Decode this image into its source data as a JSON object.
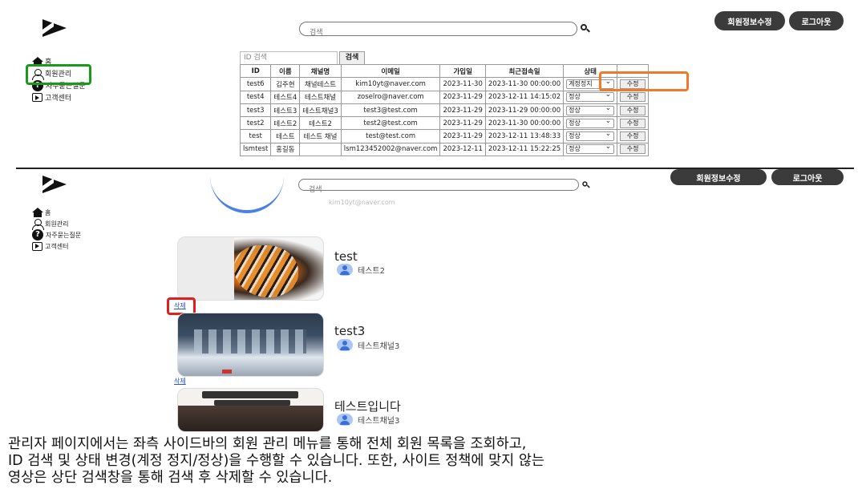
{
  "top": {
    "search_placeholder": "검색",
    "edit_profile_button": "회원정보수정",
    "logout_button": "로그아웃",
    "sidebar": [
      "홈",
      "회원관리",
      "자주묻는질문",
      "고객센터"
    ],
    "id_search_placeholder": "ID 검색",
    "id_search_button": "검색",
    "table": {
      "headers": [
        "ID",
        "이름",
        "채널명",
        "이메일",
        "가입일",
        "최근접속일",
        "상태",
        ""
      ],
      "rows": [
        {
          "id": "test6",
          "name": "김주현",
          "channel": "채널테스트",
          "email": "kim10yt@naver.com",
          "joined": "2023-11-30",
          "last": "2023-11-30 00:00:00",
          "status": "계정정지",
          "action": "수정"
        },
        {
          "id": "test4",
          "name": "테스트4",
          "channel": "테스트채널",
          "email": "zoselro@naver.com",
          "joined": "2023-11-29",
          "last": "2023-12-11 14:15:02",
          "status": "정상",
          "action": "수정"
        },
        {
          "id": "test3",
          "name": "테스트3",
          "channel": "테스트채널3",
          "email": "test3@test.com",
          "joined": "2023-11-29",
          "last": "2023-11-29 00:00:00",
          "status": "정상",
          "action": "수정"
        },
        {
          "id": "test2",
          "name": "테스트2",
          "channel": "테스트2",
          "email": "test2@test.com",
          "joined": "2023-11-29",
          "last": "2023-11-30 00:00:00",
          "status": "정상",
          "action": "수정"
        },
        {
          "id": "test",
          "name": "테스트",
          "channel": "테스트 채널",
          "email": "test@test.com",
          "joined": "2023-11-29",
          "last": "2023-12-11 13:48:33",
          "status": "정상",
          "action": "수정"
        },
        {
          "id": "lsmtest",
          "name": "홍길동",
          "channel": "",
          "email": "lsm123452002@naver.com",
          "joined": "2023-12-11",
          "last": "2023-12-11 15:22:25",
          "status": "정상",
          "action": "수정"
        }
      ]
    }
  },
  "bottom": {
    "search_placeholder": "검색",
    "edit_profile_button": "회원정보수정",
    "logout_button": "로그아웃",
    "sidebar": [
      "홈",
      "회원관리",
      "자주묻는질문",
      "고객센터"
    ],
    "partial_email": "kim10yt@naver.com",
    "videos": [
      {
        "title": "test",
        "channel": "테스트2",
        "delete": "삭제"
      },
      {
        "title": "test3",
        "channel": "테스트채널3",
        "delete": "삭제"
      },
      {
        "title": "테스트입니다",
        "channel": "테스트채널3"
      }
    ]
  },
  "caption": [
    "관리자 페이지에서는 좌측 사이드바의 회원 관리 메뉴를 통해 전체 회원 목록을 조회하고,",
    "ID 검색 및 상태 변경(계정 정지/정상)을 수행할 수 있습니다. 또한, 사이트 정책에 맞지 않는",
    "영상은 상단 검색창을 통해 검색 후 삭제할 수 있습니다."
  ],
  "highlight_colors": {
    "sidebar": "#1a9a1a",
    "status": "#f07a2a",
    "delete": "#e02020"
  }
}
